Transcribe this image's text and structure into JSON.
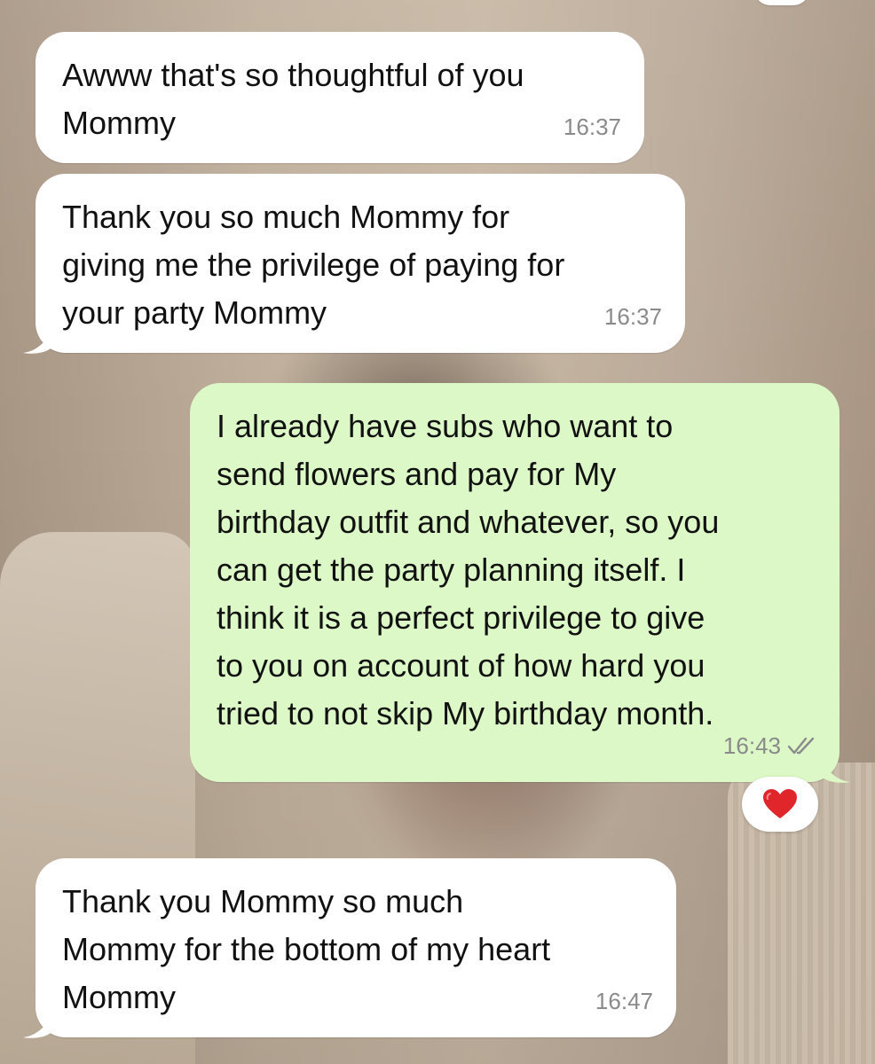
{
  "messages": [
    {
      "direction": "incoming",
      "text": "Awww that's so thoughtful of you\nMommy",
      "time": "16:37"
    },
    {
      "direction": "incoming",
      "text": "Thank you so much Mommy for\ngiving me the privilege of paying for\nyour party Mommy",
      "time": "16:37"
    },
    {
      "direction": "outgoing",
      "text": "I already have subs who want to\nsend flowers and pay for My\nbirthday outfit and whatever, so you\ncan get the party planning itself. I\nthink it is a perfect privilege to give\nto you on account of how hard you\ntried to not skip My birthday month.",
      "time": "16:43",
      "status_icon": "double-check-icon",
      "reaction_icon": "red-heart-icon"
    },
    {
      "direction": "incoming",
      "text": "Thank you Mommy so much\nMommy for the bottom of my heart\nMommy",
      "time": "16:47"
    }
  ],
  "colors": {
    "incoming_bubble": "#ffffff",
    "outgoing_bubble": "#dcf8c6",
    "timestamp": "#8a8a8a",
    "heart": "#e0262b"
  }
}
